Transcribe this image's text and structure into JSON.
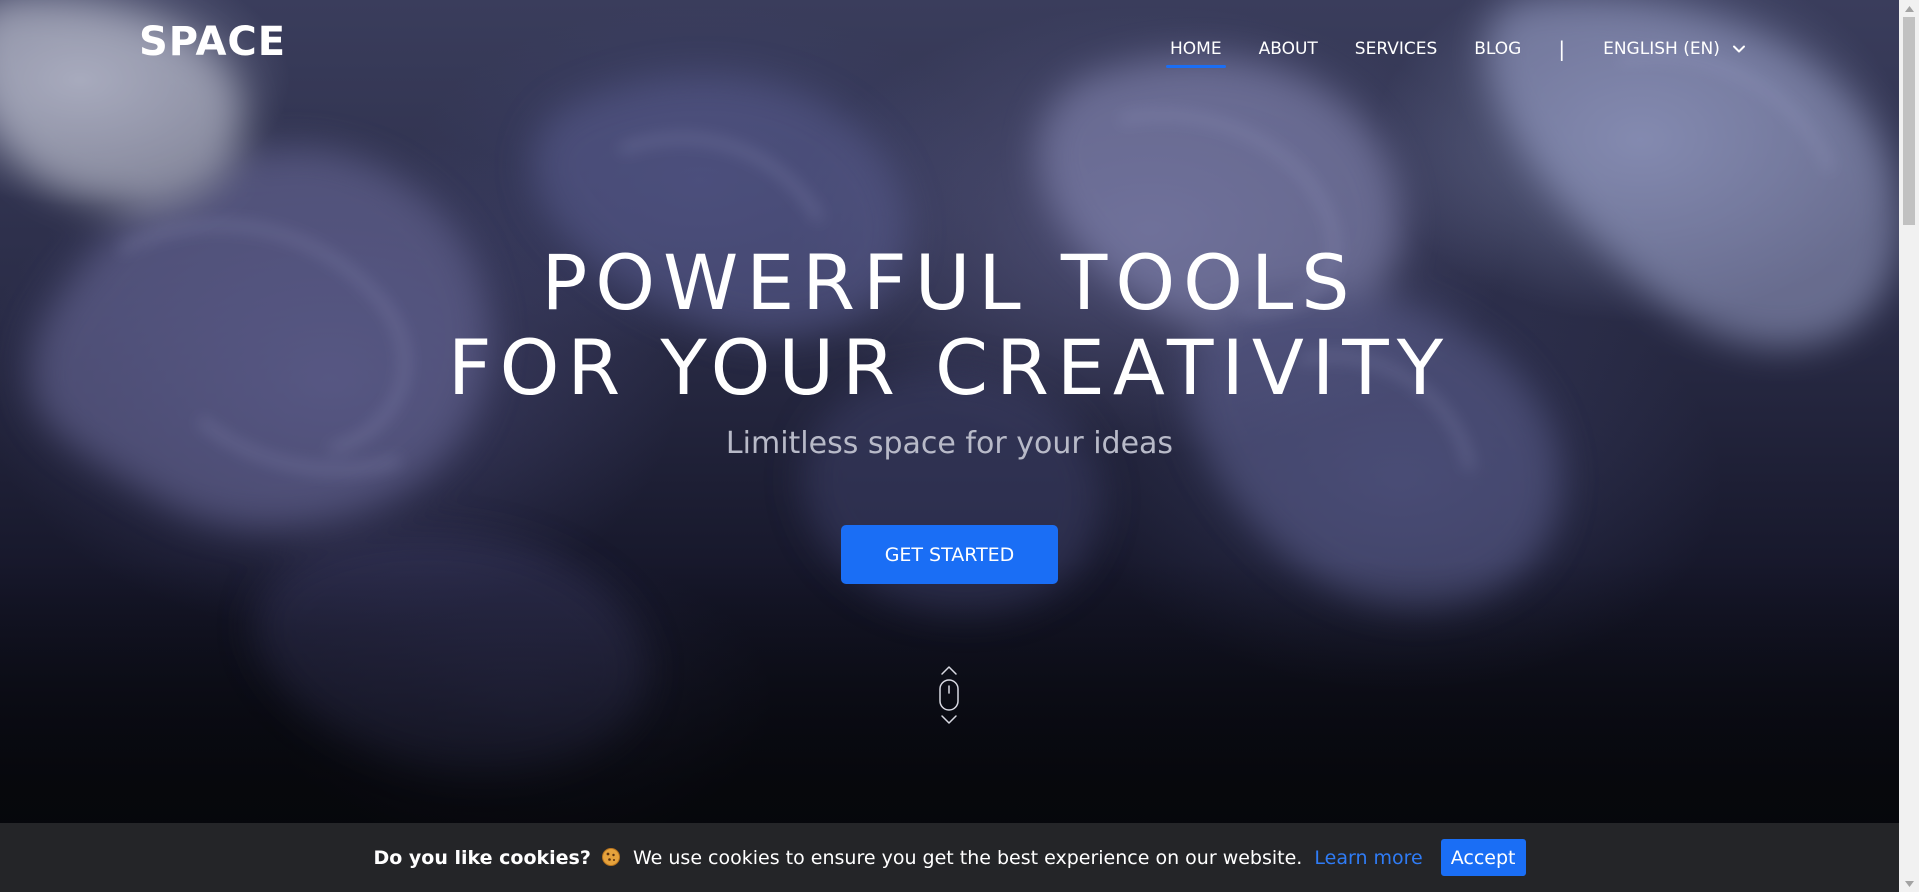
{
  "header": {
    "logo": "SPACE",
    "nav": {
      "items": [
        {
          "label": "HOME",
          "active": true
        },
        {
          "label": "ABOUT",
          "active": false
        },
        {
          "label": "SERVICES",
          "active": false
        },
        {
          "label": "BLOG",
          "active": false
        }
      ],
      "separator": "|",
      "language": "ENGLISH (EN)"
    }
  },
  "hero": {
    "headline_line1": "POWERFUL TOOLS",
    "headline_line2": "FOR YOUR CREATIVITY",
    "subheadline": "Limitless space for your ideas",
    "cta_label": "GET STARTED"
  },
  "cookie_banner": {
    "title": "Do you like cookies?",
    "message": "We use cookies to ensure you get the best experience on our website.",
    "learn_more": "Learn more",
    "accept_label": "Accept"
  },
  "colors": {
    "accent": "#1a6ef5",
    "cookie_bar_bg": "#242528",
    "link": "#2f7cf6"
  },
  "icons": {
    "language_dropdown": "chevron-down-icon",
    "scroll_hint": "mouse-scroll-icon",
    "cookie_emoji": "cookie-icon"
  }
}
